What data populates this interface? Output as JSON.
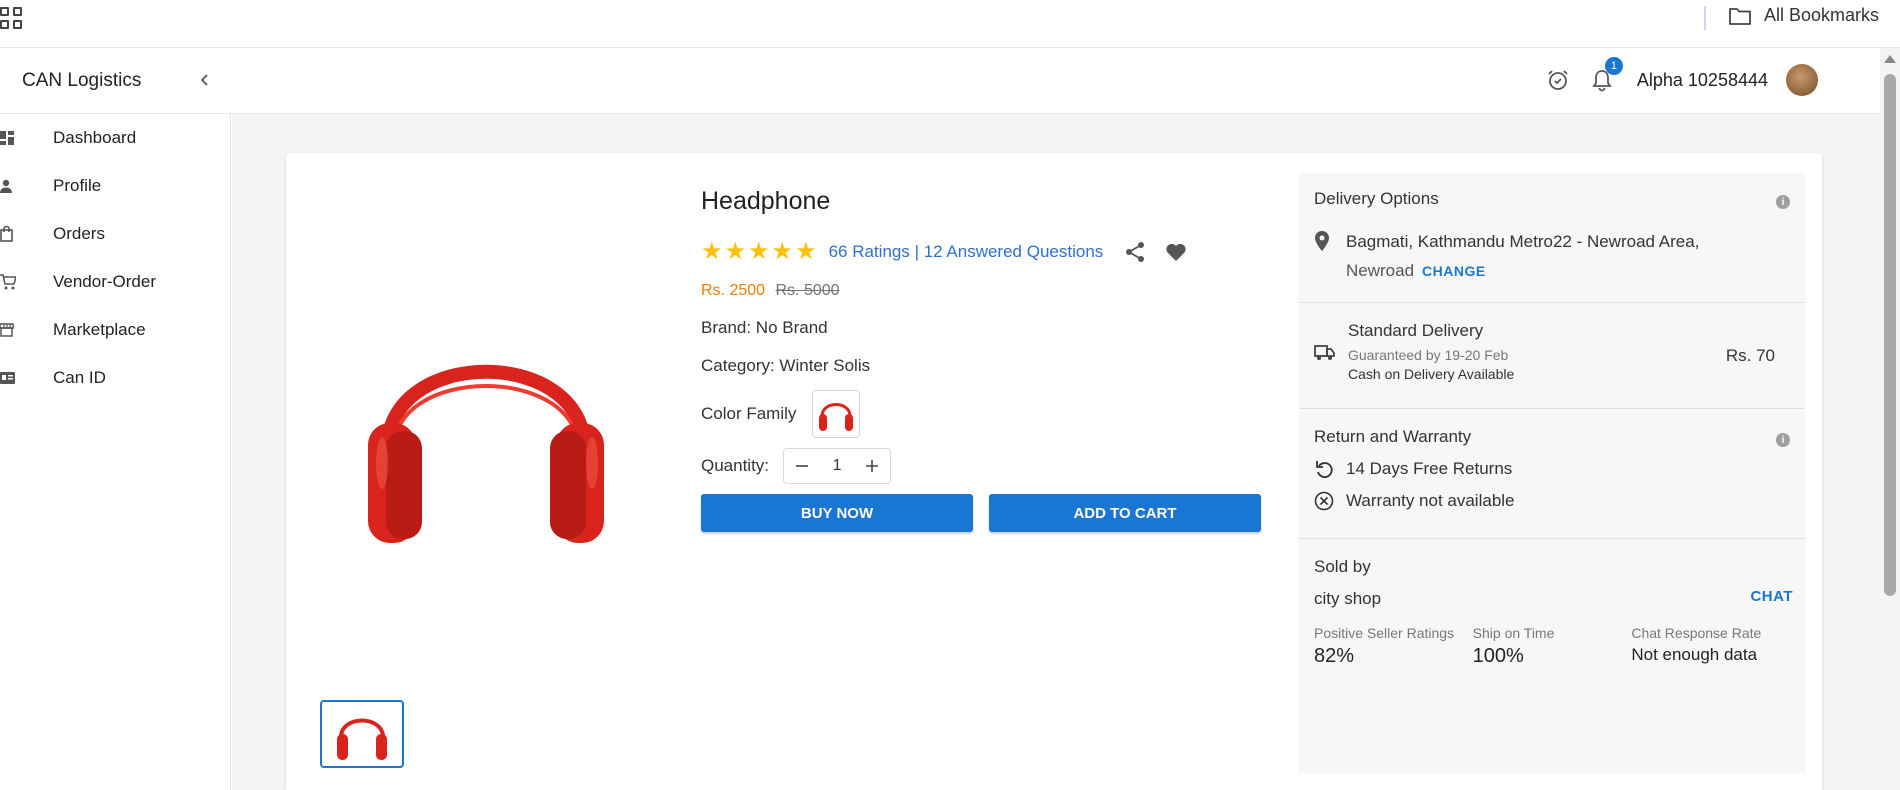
{
  "bookmarks": {
    "all_label": "All Bookmarks"
  },
  "header": {
    "brand": "CAN Logistics",
    "notification_count": "1",
    "user_name": "Alpha 10258444"
  },
  "sidebar": {
    "items": [
      {
        "label": "Dashboard",
        "icon": "dashboard-icon"
      },
      {
        "label": "Profile",
        "icon": "person-icon"
      },
      {
        "label": "Orders",
        "icon": "shopping-bag-icon"
      },
      {
        "label": "Vendor-Order",
        "icon": "cart-icon"
      },
      {
        "label": "Marketplace",
        "icon": "store-icon"
      },
      {
        "label": "Can ID",
        "icon": "id-card-icon"
      }
    ]
  },
  "product": {
    "title": "Headphone",
    "rating_count": 5,
    "ratings_link": "66 Ratings | 12 Answered Questions",
    "price": "Rs. 2500",
    "old_price": "Rs. 5000",
    "brand_line": "Brand: No Brand",
    "category_line": "Category: Winter Solis",
    "color_label": "Color Family",
    "quantity_label": "Quantity:",
    "quantity": "1",
    "buy_now": "BUY NOW",
    "add_to_cart": "ADD TO CART",
    "accent_color": "#1976d2",
    "price_color": "#f57c00"
  },
  "delivery": {
    "title": "Delivery Options",
    "address_line1": "Bagmati, Kathmandu Metro22 - Newroad Area,",
    "address_line2": "Newroad",
    "change": "CHANGE",
    "standard": "Standard Delivery",
    "guaranteed": "Guaranteed by 19-20 Feb",
    "cod": "Cash on Delivery Available",
    "delivery_price": "Rs. 70"
  },
  "warranty": {
    "title": "Return and Warranty",
    "returns": "14 Days Free Returns",
    "warranty": "Warranty not available"
  },
  "seller": {
    "title": "Sold by",
    "name": "city shop",
    "chat": "CHAT",
    "stat1_label": "Positive Seller Ratings",
    "stat1_value": "82%",
    "stat2_label": "Ship on Time",
    "stat2_value": "100%",
    "stat3_label": "Chat Response Rate",
    "stat3_value": "Not enough data"
  }
}
